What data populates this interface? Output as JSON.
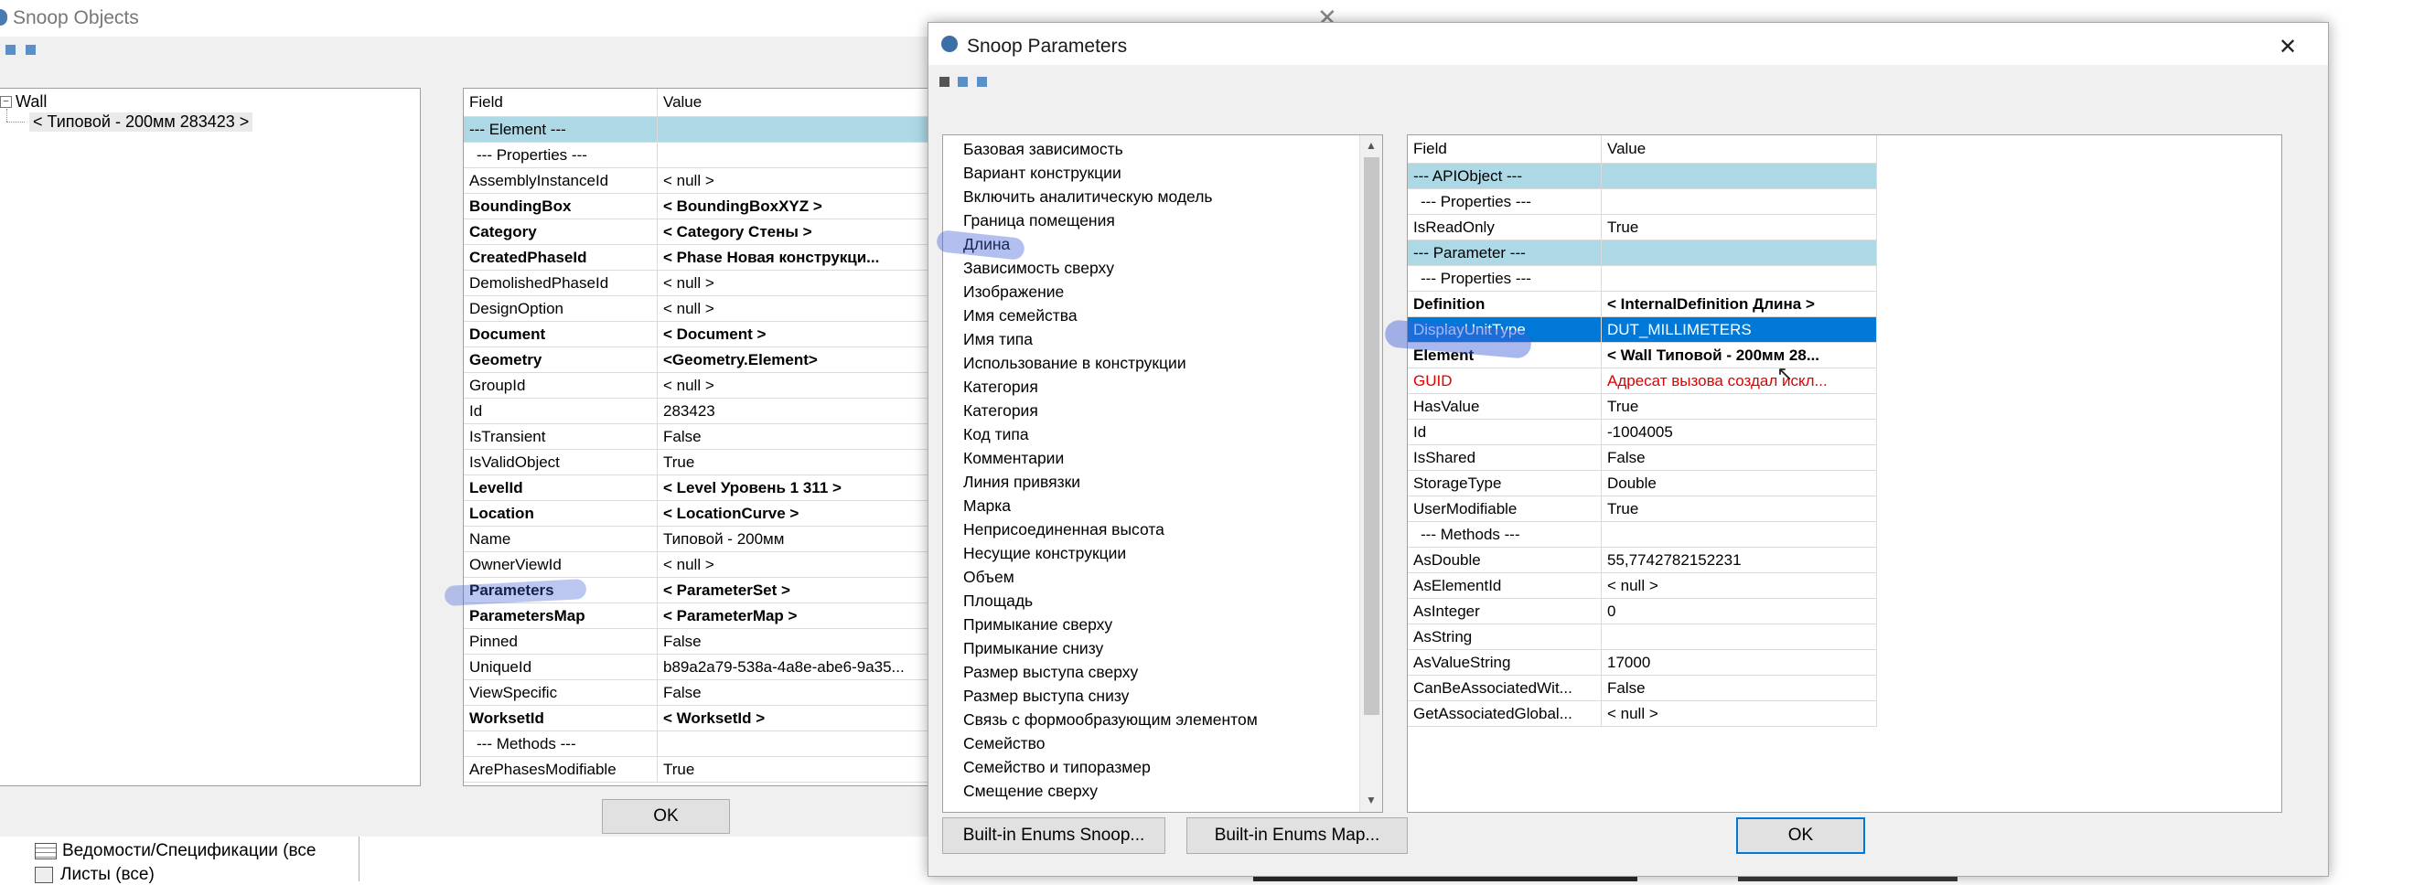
{
  "snoop_objects": {
    "title": "Snoop Objects",
    "tree": {
      "root": "Wall",
      "child": "< Типовой - 200мм  283423 >"
    },
    "grid": {
      "headers": [
        "Field",
        "Value"
      ],
      "rows": [
        {
          "field": "--- Element ---",
          "value": "",
          "kind": "section"
        },
        {
          "field": "--- Properties ---",
          "value": "",
          "kind": "sub"
        },
        {
          "field": "AssemblyInstanceId",
          "value": "< null >",
          "kind": "normal"
        },
        {
          "field": "BoundingBox",
          "value": "< BoundingBoxXYZ >",
          "kind": "bold"
        },
        {
          "field": "Category",
          "value": "< Category  Стены >",
          "kind": "bold"
        },
        {
          "field": "CreatedPhaseId",
          "value": "< Phase  Новая конструкци...",
          "kind": "bold"
        },
        {
          "field": "DemolishedPhaseId",
          "value": "< null >",
          "kind": "normal"
        },
        {
          "field": "DesignOption",
          "value": "< null >",
          "kind": "normal"
        },
        {
          "field": "Document",
          "value": "< Document >",
          "kind": "bold"
        },
        {
          "field": "Geometry",
          "value": "<Geometry.Element>",
          "kind": "bold"
        },
        {
          "field": "GroupId",
          "value": "< null >",
          "kind": "normal"
        },
        {
          "field": "Id",
          "value": "283423",
          "kind": "normal"
        },
        {
          "field": "IsTransient",
          "value": "False",
          "kind": "normal"
        },
        {
          "field": "IsValidObject",
          "value": "True",
          "kind": "normal"
        },
        {
          "field": "LevelId",
          "value": "< Level  Уровень 1   311 >",
          "kind": "bold"
        },
        {
          "field": "Location",
          "value": "< LocationCurve >",
          "kind": "bold"
        },
        {
          "field": "Name",
          "value": "Типовой - 200мм",
          "kind": "normal"
        },
        {
          "field": "OwnerViewId",
          "value": "< null >",
          "kind": "normal"
        },
        {
          "field": "Parameters",
          "value": "< ParameterSet >",
          "kind": "bold"
        },
        {
          "field": "ParametersMap",
          "value": "< ParameterMap >",
          "kind": "bold"
        },
        {
          "field": "Pinned",
          "value": "False",
          "kind": "normal"
        },
        {
          "field": "UniqueId",
          "value": "b89a2a79-538a-4a8e-abe6-9a35...",
          "kind": "normal"
        },
        {
          "field": "ViewSpecific",
          "value": "False",
          "kind": "normal"
        },
        {
          "field": "WorksetId",
          "value": "< WorksetId >",
          "kind": "bold"
        },
        {
          "field": "--- Methods ---",
          "value": "",
          "kind": "sub"
        },
        {
          "field": "ArePhasesModifiable",
          "value": "True",
          "kind": "normal"
        }
      ]
    },
    "ok_label": "OK"
  },
  "background_tree": {
    "items": [
      "Ведомости/Спецификации (все",
      "Листы (все)"
    ]
  },
  "snoop_parameters": {
    "title": "Snoop Parameters",
    "list": [
      "Базовая зависимость",
      "Вариант конструкции",
      "Включить аналитическую модель",
      "Граница помещения",
      "Длина",
      "Зависимость сверху",
      "Изображение",
      "Имя семейства",
      "Имя типа",
      "Использование в конструкции",
      "Категория",
      "Категория",
      "Код типа",
      "Комментарии",
      "Линия привязки",
      "Марка",
      "Неприсоединенная высота",
      "Несущие конструкции",
      "Объем",
      "Площадь",
      "Примыкание сверху",
      "Примыкание снизу",
      "Размер выступа сверху",
      "Размер выступа снизу",
      "Связь с формообразующим элементом",
      "Семейство",
      "Семейство и типоразмер",
      "Смещение сверху"
    ],
    "grid": {
      "headers": [
        "Field",
        "Value"
      ],
      "rows": [
        {
          "field": "--- APIObject ---",
          "value": "",
          "kind": "section"
        },
        {
          "field": "--- Properties ---",
          "value": "",
          "kind": "sub"
        },
        {
          "field": "IsReadOnly",
          "value": "True",
          "kind": "normal"
        },
        {
          "field": "--- Parameter ---",
          "value": "",
          "kind": "section"
        },
        {
          "field": "--- Properties ---",
          "value": "",
          "kind": "sub"
        },
        {
          "field": "Definition",
          "value": "< InternalDefinition  Длина >",
          "kind": "bold"
        },
        {
          "field": "DisplayUnitType",
          "value": "DUT_MILLIMETERS",
          "kind": "selected"
        },
        {
          "field": "Element",
          "value": "< Wall  Типовой - 200мм  28...",
          "kind": "bold"
        },
        {
          "field": "GUID",
          "value": "Адресат вызова создал искл...",
          "kind": "error"
        },
        {
          "field": "HasValue",
          "value": "True",
          "kind": "normal"
        },
        {
          "field": "Id",
          "value": "-1004005",
          "kind": "normal"
        },
        {
          "field": "IsShared",
          "value": "False",
          "kind": "normal"
        },
        {
          "field": "StorageType",
          "value": "Double",
          "kind": "normal"
        },
        {
          "field": "UserModifiable",
          "value": "True",
          "kind": "normal"
        },
        {
          "field": "--- Methods ---",
          "value": "",
          "kind": "sub"
        },
        {
          "field": "AsDouble",
          "value": "55,7742782152231",
          "kind": "normal"
        },
        {
          "field": "AsElementId",
          "value": "< null >",
          "kind": "normal"
        },
        {
          "field": "AsInteger",
          "value": "0",
          "kind": "normal"
        },
        {
          "field": "AsString",
          "value": "",
          "kind": "normal"
        },
        {
          "field": "AsValueString",
          "value": "17000",
          "kind": "normal"
        },
        {
          "field": "CanBeAssociatedWit...",
          "value": "False",
          "kind": "normal"
        },
        {
          "field": "GetAssociatedGlobal...",
          "value": "< null >",
          "kind": "normal"
        }
      ]
    },
    "buttons": {
      "enums_snoop": "Built-in Enums Snoop...",
      "enums_map": "Built-in Enums Map...",
      "ok": "OK"
    }
  },
  "colors": {
    "section_bg": "#add8e6",
    "selection_bg": "#0078d7",
    "highlighter": "#3e5fd6",
    "error_text": "#e00000"
  }
}
